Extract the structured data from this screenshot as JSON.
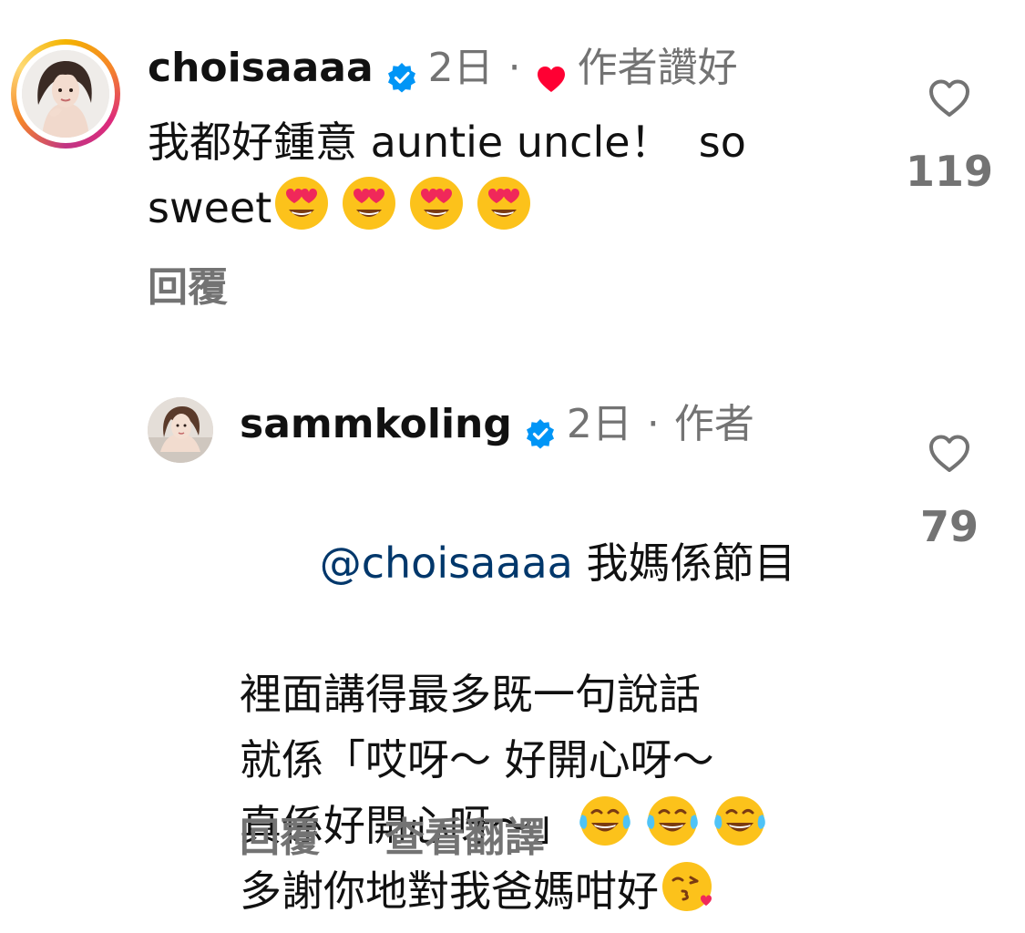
{
  "comments": [
    {
      "username": "choisaaaa",
      "time": "2日",
      "separator": "·",
      "author_liked": "作者讚好",
      "text_line1": "我都好鍾意 auntie uncle！  so",
      "text_line2": "sweet",
      "emojis_line2": [
        "heart-eyes-emoji",
        "heart-eyes-emoji",
        "heart-eyes-emoji",
        "heart-eyes-emoji"
      ],
      "reply_label": "回覆",
      "like_count": "119"
    },
    {
      "username": "sammkoling",
      "time": "2日",
      "separator": "·",
      "author_tag": "作者",
      "mention": "@choisaaaa",
      "text_line1_after_mention": " 我媽係節目",
      "text_line2": "裡面講得最多既一句說話",
      "text_line3": "就係「哎呀～ 好開心呀～",
      "text_line4": "真係好開心呀～」",
      "emojis_line4": [
        "tears-of-joy-emoji",
        "tears-of-joy-emoji",
        "tears-of-joy-emoji"
      ],
      "text_line5": "多謝你地對我爸媽咁好",
      "emojis_line5": [
        "kissing-heart-emoji"
      ],
      "reply_label": "回覆",
      "translate_label": "查看翻譯",
      "like_count": "79"
    }
  ],
  "colors": {
    "text": "#111111",
    "meta": "#737373",
    "mention": "#00376b",
    "verified": "#0095f6",
    "heart_red": "#ff0033"
  }
}
